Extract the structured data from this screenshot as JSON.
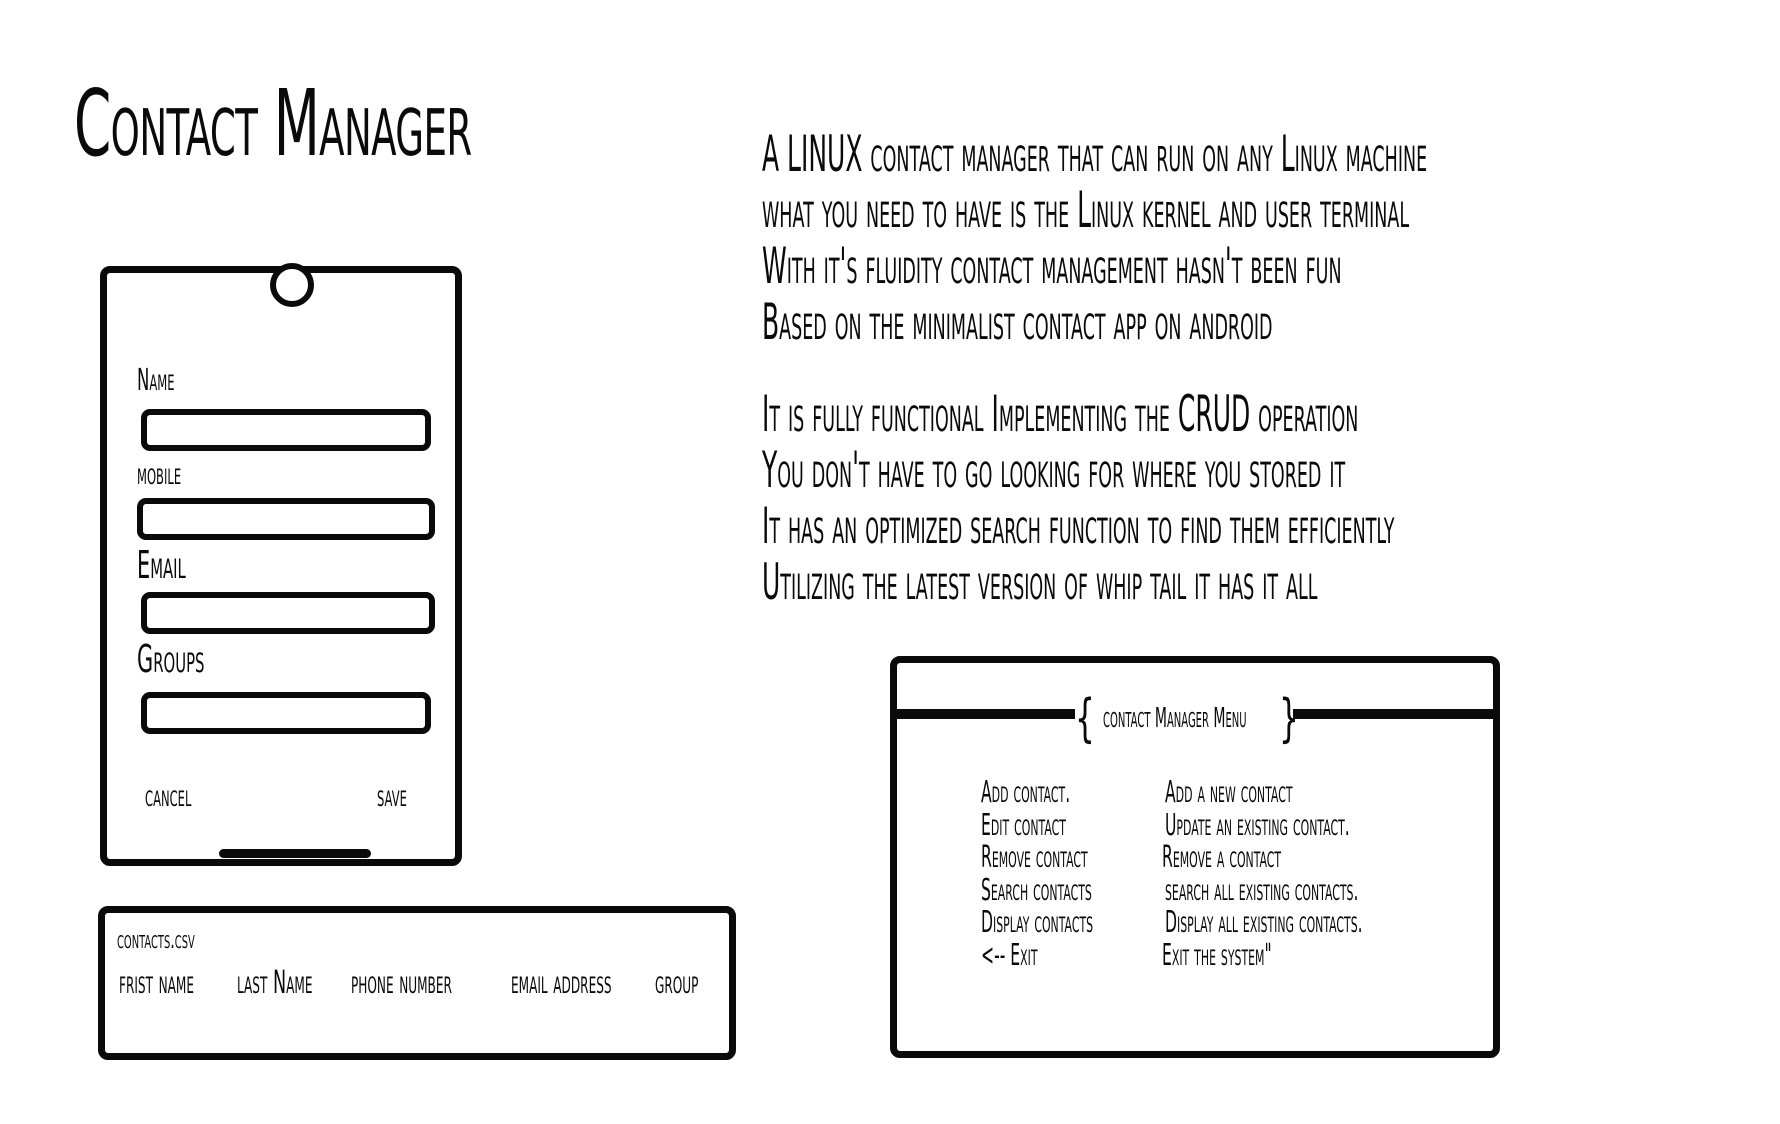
{
  "title": "Contact Manager",
  "description": {
    "paragraph1": [
      "A LINUX contact manager that can run on any Linux machine",
      "what you need to have is the Linux kernel and user terminal",
      "With it's fluidity contact management hasn't been fun",
      "Based on the minimalist contact app on android"
    ],
    "paragraph2": [
      "It is fully functional Implementing the CRUD operation",
      "You don't have to go looking for where you stored it",
      "It has an optimized search function to find them efficiently",
      "Utilizing the latest version of whip tail it has it all"
    ]
  },
  "phone_form": {
    "fields": [
      {
        "label": "Name",
        "value": ""
      },
      {
        "label": "mobile",
        "value": ""
      },
      {
        "label": "Email",
        "value": ""
      },
      {
        "label": "Groups",
        "value": ""
      }
    ],
    "cancel_label": "cancel",
    "save_label": "save"
  },
  "csv": {
    "filename": "contacts.csv",
    "columns": [
      "frist name",
      "last Name",
      "phone number",
      "email address",
      "group"
    ]
  },
  "menu": {
    "brace_left": "{",
    "brace_right": "}",
    "title": "contact Manager Menu",
    "items": [
      {
        "command": "Add contact.",
        "description": "Add a new contact"
      },
      {
        "command": "Edit contact",
        "description": "Update an existing contact."
      },
      {
        "command": "Remove contact",
        "description": "Remove a contact"
      },
      {
        "command": "Search contacts",
        "description": "search all existing contacts."
      },
      {
        "command": "Display contacts",
        "description": "Display all existing contacts."
      },
      {
        "command": "<-- Exit",
        "description": "Exit the system\""
      }
    ]
  }
}
